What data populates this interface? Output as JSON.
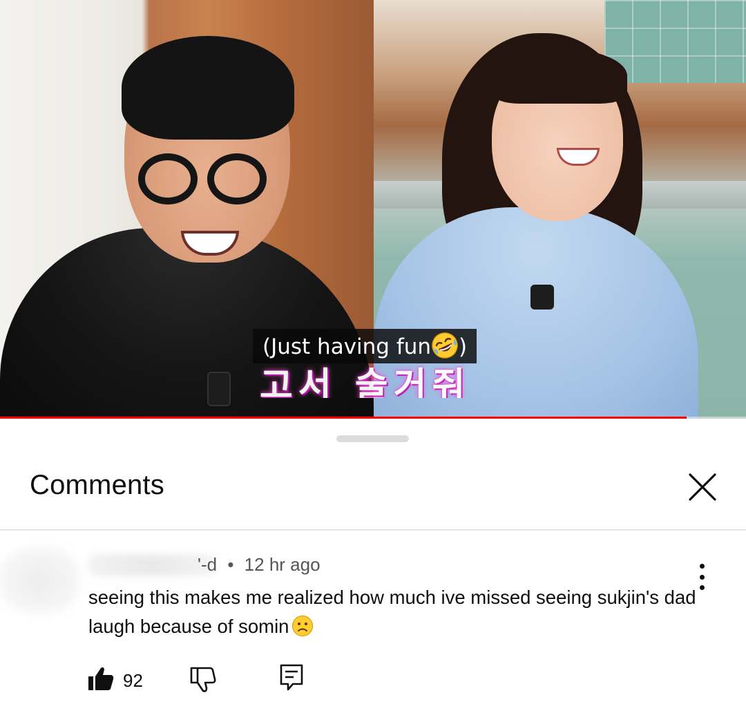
{
  "video": {
    "caption_text": "(Just having fun",
    "caption_close": ")",
    "caption_emoji": "rolling-on-floor-laughing-emoji",
    "overlay_text": "고서 술거줘",
    "progress": 0.92
  },
  "comments_sheet": {
    "title": "Comments",
    "close_icon": "close-icon",
    "comment": {
      "author_visible_fragment": "'-d",
      "separator": "•",
      "timestamp": "12 hr ago",
      "text": "seeing this makes me realized how much ive missed seeing sukjin's dad laugh because of somin",
      "text_emoji": "sad-face-emoji",
      "like_count": "92",
      "more_icon": "more-vertical-icon",
      "like_icon": "thumbs-up-icon",
      "dislike_icon": "thumbs-down-icon",
      "reply_icon": "reply-icon"
    }
  },
  "colors": {
    "progress": "#ff0000",
    "caption_bg": "#080808",
    "text_primary": "#0f0f0f",
    "text_secondary": "#555555",
    "divider": "#e5e5e5",
    "drag_handle": "#dcdcdc"
  }
}
